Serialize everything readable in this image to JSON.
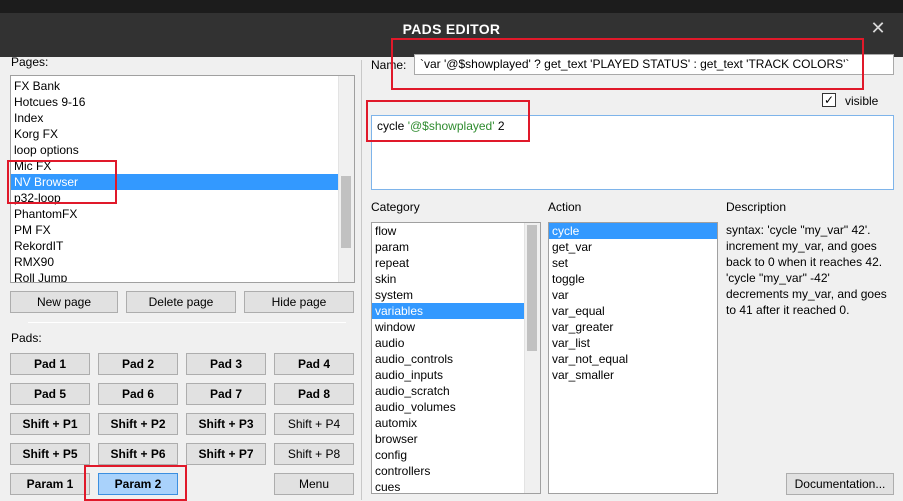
{
  "window": {
    "title": "PADS EDITOR",
    "close_glyph": "✕"
  },
  "pages": {
    "label": "Pages:",
    "items": [
      "FX Bank",
      "Hotcues 9-16",
      "Index",
      "Korg FX",
      "loop options",
      "Mic FX",
      "NV Browser",
      "p32-loop",
      "PhantomFX",
      "PM FX",
      "RekordIT",
      "RMX90",
      "Roll Jump"
    ],
    "selected": "NV Browser",
    "buttons": {
      "new": "New page",
      "delete": "Delete page",
      "hide": "Hide page"
    }
  },
  "pads": {
    "label": "Pads:",
    "rows": [
      [
        "Pad 1",
        "Pad 2",
        "Pad 3",
        "Pad 4"
      ],
      [
        "Pad 5",
        "Pad 6",
        "Pad 7",
        "Pad 8"
      ],
      [
        "Shift + P1",
        "Shift + P2",
        "Shift + P3",
        "Shift + P4"
      ],
      [
        "Shift + P5",
        "Shift + P6",
        "Shift + P7",
        "Shift + P8"
      ]
    ],
    "bottom": {
      "param1": "Param 1",
      "param2": "Param 2",
      "menu": "Menu"
    }
  },
  "editor": {
    "name_label": "Name:",
    "name_value": "`var '@$showplayed' ? get_text 'PLAYED STATUS' : get_text 'TRACK COLORS'`",
    "visible_label": "visible",
    "visible_checked": "✓",
    "script_prefix": "cycle ",
    "script_var": "'@$showplayed'",
    "script_suffix": " 2"
  },
  "category": {
    "label": "Category",
    "items": [
      "flow",
      "param",
      "repeat",
      "skin",
      "system",
      "variables",
      "window",
      "audio",
      "audio_controls",
      "audio_inputs",
      "audio_scratch",
      "audio_volumes",
      "automix",
      "browser",
      "config",
      "controllers",
      "cues"
    ],
    "selected": "variables"
  },
  "action": {
    "label": "Action",
    "items": [
      "cycle",
      "get_var",
      "set",
      "toggle",
      "var",
      "var_equal",
      "var_greater",
      "var_list",
      "var_not_equal",
      "var_smaller"
    ],
    "selected": "cycle"
  },
  "description": {
    "label": "Description",
    "lines": [
      "syntax: 'cycle \"my_var\" 42'.",
      "increment my_var, and goes",
      "back to 0 when it reaches 42.",
      "'cycle \"my_var\" -42'",
      "decrements my_var, and goes",
      "to 41 after it reached 0."
    ],
    "doc_button": "Documentation..."
  },
  "colors": {
    "selection": "#3399ff",
    "highlight": "#e0192a",
    "active_button": "#a9d2fb",
    "titlebar": "#323232"
  }
}
